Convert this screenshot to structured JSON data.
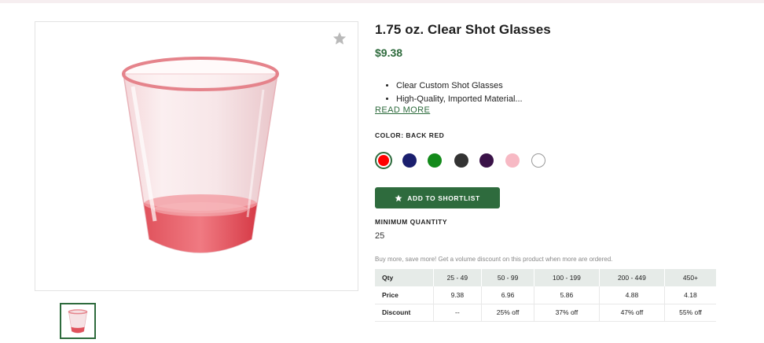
{
  "product": {
    "title": "1.75 oz. Clear Shot Glasses",
    "price": "$9.38",
    "bullets": [
      "Clear Custom Shot Glasses",
      "High-Quality, Imported Material..."
    ],
    "read_more": "READ MORE",
    "color_label": "COLOR: BACK RED",
    "swatches": [
      {
        "name": "red",
        "color": "#ff0000",
        "selected": true
      },
      {
        "name": "navy",
        "color": "#1b1f6e"
      },
      {
        "name": "green",
        "color": "#138a1a"
      },
      {
        "name": "charcoal",
        "color": "#333333"
      },
      {
        "name": "purple",
        "color": "#3a1248"
      },
      {
        "name": "pink",
        "color": "#f7b9c4"
      },
      {
        "name": "white",
        "color": "#ffffff"
      }
    ],
    "shortlist_label": "ADD TO SHORTLIST",
    "min_qty_label": "MINIMUM QUANTITY",
    "min_qty_value": "25",
    "volume_note": "Buy more, save more! Get a volume discount on this product when more are ordered."
  },
  "pricing_table": {
    "headers": [
      "Qty",
      "25 - 49",
      "50 - 99",
      "100 - 199",
      "200 - 449",
      "450+"
    ],
    "rows": [
      {
        "label": "Price",
        "cells": [
          "9.38",
          "6.96",
          "5.86",
          "4.88",
          "4.18"
        ]
      },
      {
        "label": "Discount",
        "cells": [
          "--",
          "25% off",
          "37% off",
          "47% off",
          "55% off"
        ]
      }
    ]
  },
  "colors": {
    "accent": "#2e6b3d",
    "glass_tint": "#e23a47"
  },
  "icons": {
    "favorite": "star-icon",
    "shortlist": "star-icon"
  }
}
